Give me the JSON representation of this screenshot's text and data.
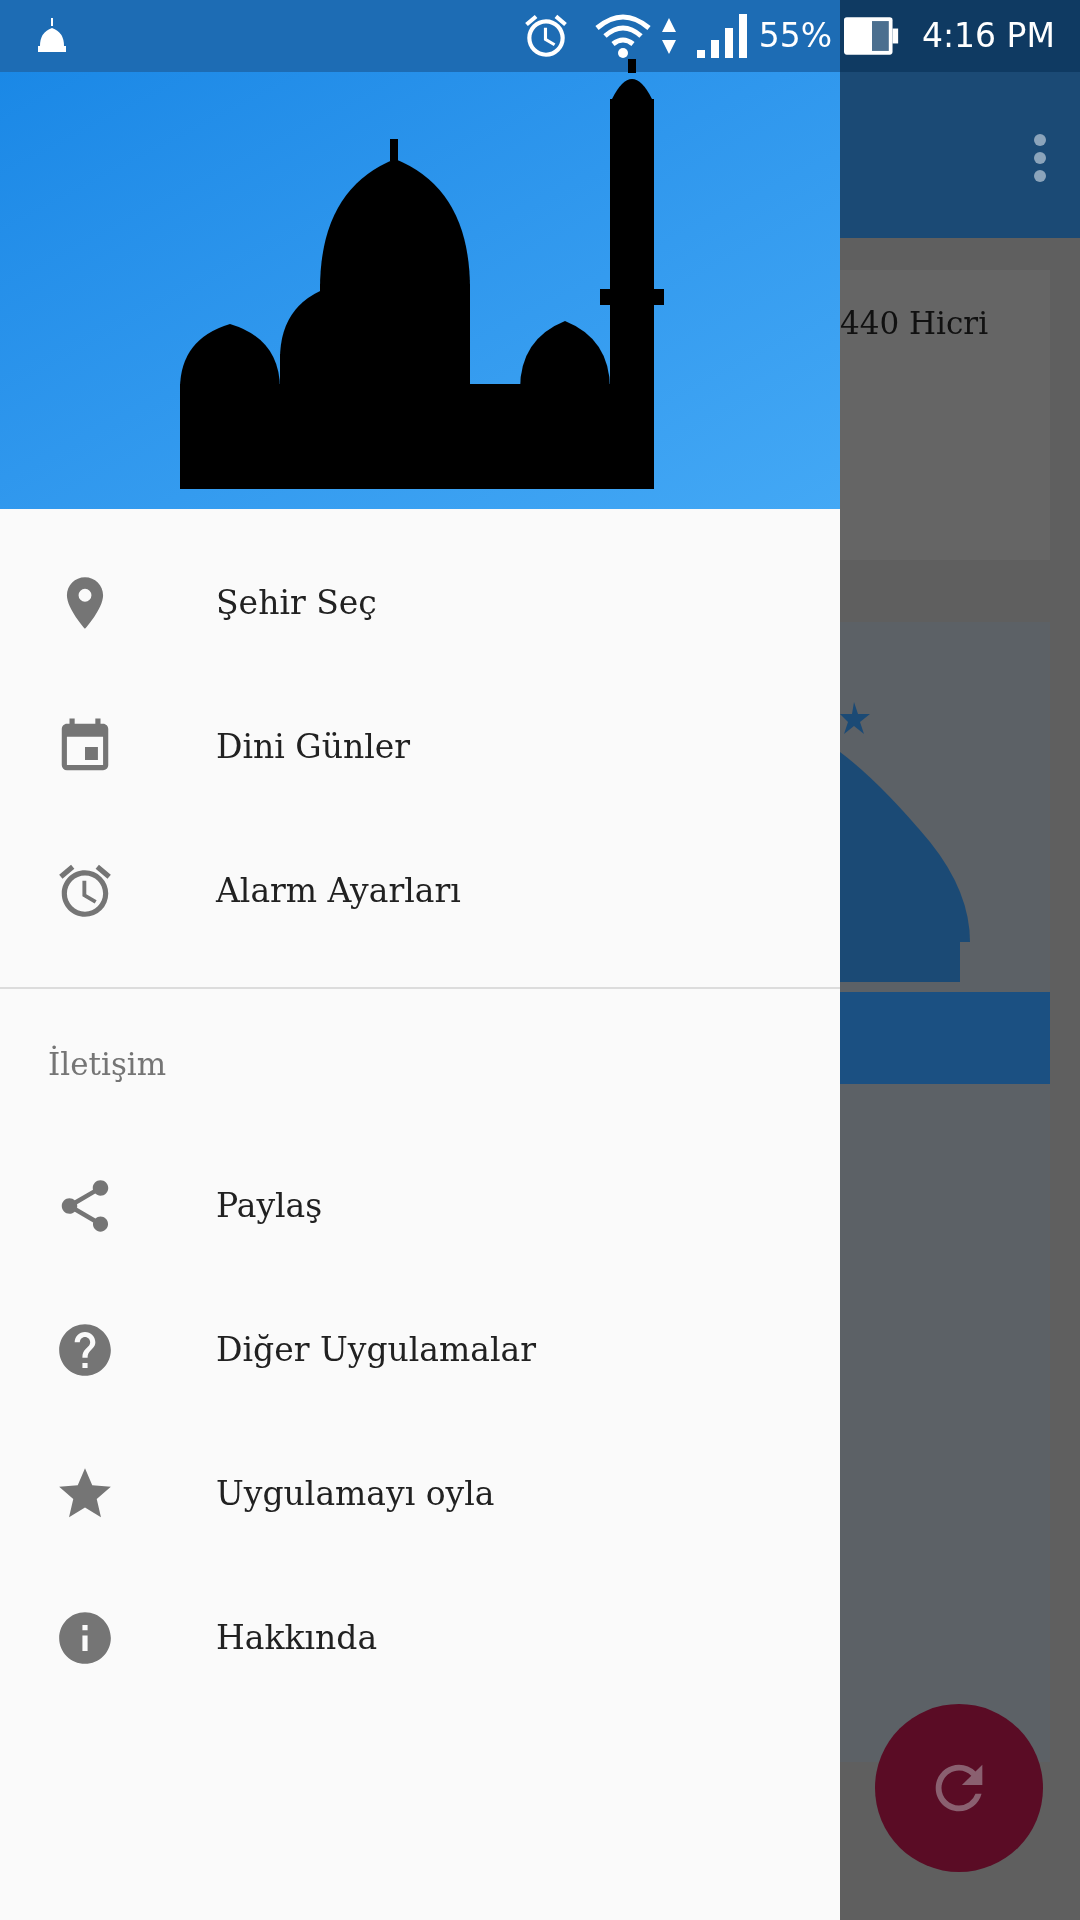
{
  "status_bar": {
    "battery": "55%",
    "time": "4:16 PM"
  },
  "drawer": {
    "items": [
      {
        "kind": "location",
        "label": "Şehir Seç"
      },
      {
        "kind": "calendar",
        "label": "Dini Günler"
      },
      {
        "kind": "alarm",
        "label": "Alarm Ayarları"
      }
    ],
    "section": {
      "title": "İletişim",
      "items": [
        {
          "kind": "share",
          "label": "Paylaş"
        },
        {
          "kind": "help",
          "label": "Diğer Uygulamalar"
        },
        {
          "kind": "star",
          "label": "Uygulamayı oyla"
        },
        {
          "kind": "info",
          "label": "Hakkında"
        }
      ]
    }
  },
  "background_screen": {
    "date_card": {
      "text": "440 Hicri"
    }
  }
}
